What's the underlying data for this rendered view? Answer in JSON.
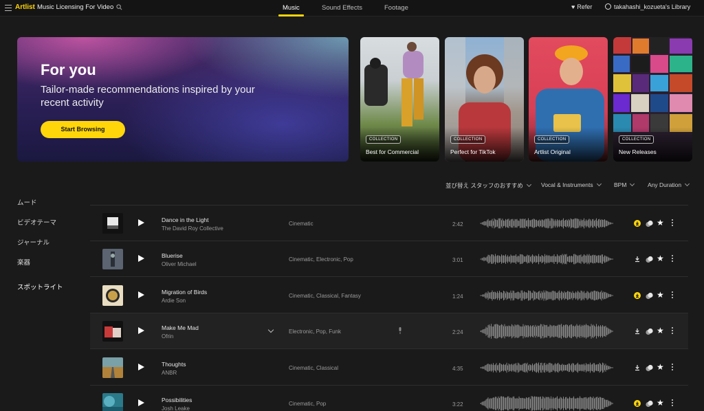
{
  "topbar": {
    "logo": "Artlist",
    "title": "Music Licensing For Video",
    "tabs": [
      "Music",
      "Sound Effects",
      "Footage"
    ],
    "active_tab": "Music",
    "refer": "Refer",
    "library": "takahashi_kozueta's Library"
  },
  "hero": {
    "title": "For you",
    "subtitle": "Tailor-made recommendations inspired by your recent activity",
    "button": "Start Browsing"
  },
  "collections": [
    {
      "badge": "COLLECTION",
      "name": "Best for Commercial"
    },
    {
      "badge": "COLLECTION",
      "name": "Perfect for TikTok"
    },
    {
      "badge": "COLLECTION",
      "name": "Artlist Original"
    },
    {
      "badge": "COLLECTION",
      "name": "New Releases"
    }
  ],
  "sidebar": {
    "items": [
      "ムード",
      "ビデオテーマ",
      "ジャーナル",
      "楽器",
      "スポットライト"
    ]
  },
  "filters": {
    "sort": "並び替え スタッフのおすすめ",
    "vocal": "Vocal & Instruments",
    "bpm": "BPM",
    "duration": "Any Duration"
  },
  "tracks": [
    {
      "title": "Dance in the Light",
      "artist": "The David Roy Collective",
      "genres": "Cinematic",
      "duration": "2:42",
      "downloaded": true
    },
    {
      "title": "Bluerise",
      "artist": "Oliver Michael",
      "genres": "Cinematic,  Electronic,  Pop",
      "duration": "3:01",
      "downloaded": false
    },
    {
      "title": "Migration of Birds",
      "artist": "Ardie Son",
      "genres": "Cinematic,  Classical,  Fantasy",
      "duration": "1:24",
      "downloaded": true
    },
    {
      "title": "Make Me Mad",
      "artist": "Ofrin",
      "genres": "Electronic,  Pop,  Funk",
      "duration": "2:24",
      "downloaded": false
    },
    {
      "title": "Thoughts",
      "artist": "ANBR",
      "genres": "Cinematic,  Classical",
      "duration": "4:35",
      "downloaded": false
    },
    {
      "title": "Possibilities",
      "artist": "Josh Leake",
      "genres": "Cinematic,  Pop",
      "duration": "3:22",
      "downloaded": true
    }
  ],
  "colors": {
    "accent": "#ffd60a",
    "background": "#1a1a1a"
  },
  "icons": [
    "hamburger-icon",
    "search-icon",
    "heart-icon",
    "user-icon",
    "play-icon",
    "download-icon",
    "similar-icon",
    "star-icon",
    "more-icon",
    "chevron-down-icon",
    "mic-icon"
  ]
}
